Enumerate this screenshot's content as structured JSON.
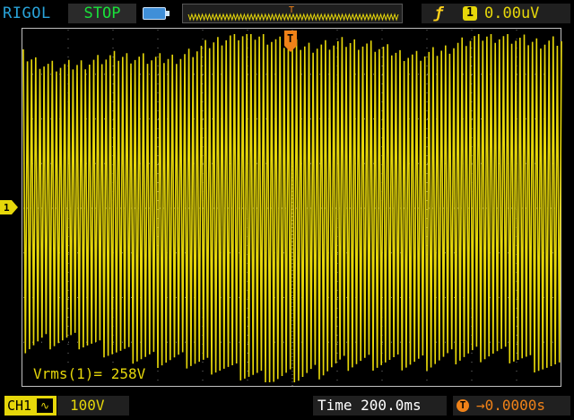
{
  "topbar": {
    "brand": "RIGOL",
    "run_status": "STOP",
    "trigger_edge_symbol": "ƒ",
    "trigger_source": "1",
    "trigger_level": "0.00uV",
    "trigger_marker_label": "T"
  },
  "display": {
    "channel_marker_label": "1",
    "trigger_marker_label": "T",
    "measurement": "Vrms(1)= 258V"
  },
  "bottombar": {
    "channel_label": "CH1",
    "coupling_symbol": "∿",
    "volts_per_div": "100V",
    "timebase": "Time 200.0ms",
    "trigger_position_icon": "T",
    "trigger_position": "→0.0000s"
  },
  "colors": {
    "channel1": "#e6d70a",
    "status_stop": "#19e13a",
    "brand": "#29a3d9",
    "trigger": "#f08218",
    "grid": "#7a7a7a"
  },
  "icons": [
    "memory-battery-icon",
    "trigger-edge-icon",
    "channel-marker-icon",
    "trigger-position-icon"
  ]
}
